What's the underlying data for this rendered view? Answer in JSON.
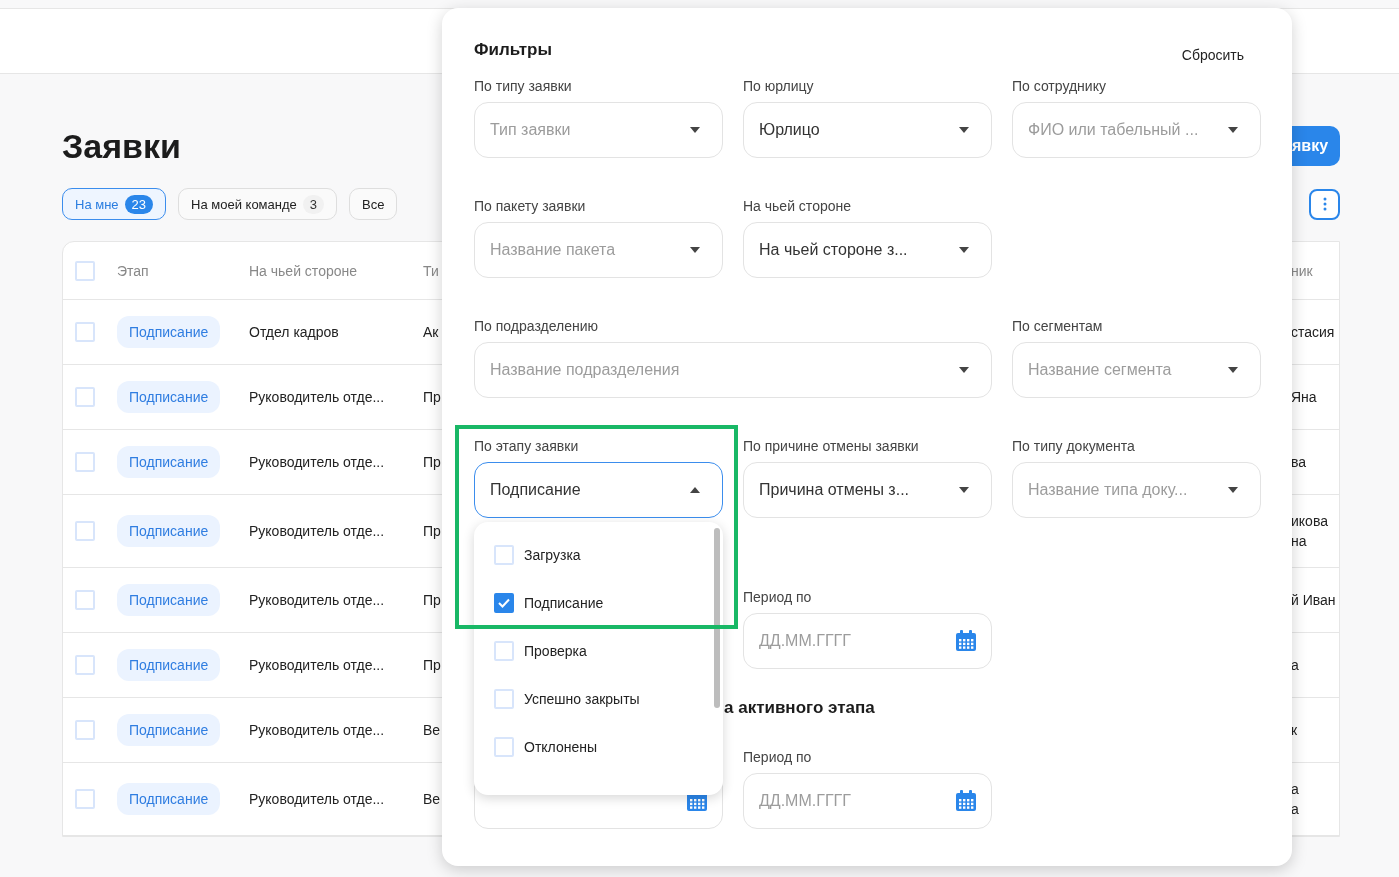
{
  "page": {
    "title": "Заявки",
    "create_button": "явку",
    "tabs": [
      {
        "label": "На мне",
        "count": "23",
        "selected": true
      },
      {
        "label": "На моей команде",
        "count": "3",
        "selected": false
      },
      {
        "label": "Все",
        "selected": false
      }
    ]
  },
  "table": {
    "all_checked": false,
    "columns": [
      "Этап",
      "На чьей стороне",
      "Ти",
      "ник"
    ],
    "rows": [
      {
        "checked": false,
        "stage": "Подписание",
        "side": "Отдел кадров",
        "column_3": "Ак",
        "column_4": [
          "стасия"
        ]
      },
      {
        "checked": false,
        "stage": "Подписание",
        "side": "Руководитель отде...",
        "column_3": "Пр",
        "column_4": [
          "Яна"
        ]
      },
      {
        "checked": false,
        "stage": "Подписание",
        "side": "Руководитель отде...",
        "column_3": "Пр",
        "column_4": [
          "ва"
        ]
      },
      {
        "checked": false,
        "stage": "Подписание",
        "side": "Руководитель отде...",
        "column_3": "Пр",
        "column_4": [
          "икова",
          "на"
        ]
      },
      {
        "checked": false,
        "stage": "Подписание",
        "side": "Руководитель отде...",
        "column_3": "Пр",
        "column_4": [
          "й Иван"
        ]
      },
      {
        "checked": false,
        "stage": "Подписание",
        "side": "Руководитель отде...",
        "column_3": "Пр",
        "column_4": [
          "а"
        ]
      },
      {
        "checked": false,
        "stage": "Подписание",
        "side": "Руководитель отде...",
        "column_3": "Ве",
        "column_4": [
          "к"
        ]
      },
      {
        "checked": false,
        "stage": "Подписание",
        "side": "Руководитель отде...",
        "column_3": "Ве",
        "column_4": [
          "а",
          "а"
        ]
      }
    ]
  },
  "filters": {
    "title": "Фильтры",
    "reset": "Сбросить",
    "fields": [
      {
        "kind": "select",
        "label": "По типу заявки",
        "placeholder": "Тип заявки"
      },
      {
        "kind": "select",
        "label": "По юрлицу",
        "value": "Юрлицо"
      },
      {
        "kind": "select",
        "label": "По сотруднику",
        "placeholder": "ФИО или табельный ..."
      },
      {
        "kind": "select",
        "label": "По пакету заявки",
        "placeholder": "Название пакета"
      },
      {
        "kind": "select",
        "label": "На чьей стороне",
        "value": "На чьей стороне з..."
      },
      {
        "kind": "empty"
      },
      {
        "kind": "wide-select",
        "label": "По подразделению",
        "placeholder": "Название подразделения"
      },
      {
        "kind": "select",
        "label": "По сегментам",
        "placeholder": "Название сегмента"
      },
      {
        "kind": "select",
        "label": "По этапу заявки",
        "value": "Подписание",
        "expanded": true,
        "options": [
          {
            "label": "Загрузка",
            "checked": false
          },
          {
            "label": "Подписание",
            "checked": true
          },
          {
            "label": "Проверка",
            "checked": false
          },
          {
            "label": "Успешно закрыты",
            "checked": false
          },
          {
            "label": "Отклонены",
            "checked": false
          }
        ]
      },
      {
        "kind": "select",
        "label": "По причине отмены заявки",
        "value": "Причина отмены з..."
      },
      {
        "kind": "select",
        "label": "По типу документа",
        "placeholder": "Название типа доку..."
      },
      {
        "kind": "empty"
      },
      {
        "kind": "date",
        "label": "Период по",
        "placeholder": "ДД.ММ.ГГГГ"
      },
      {
        "kind": "empty"
      },
      {
        "kind": "heading",
        "text": "а активного этапа"
      },
      {
        "kind": "date-bare"
      },
      {
        "kind": "date",
        "label": "Период по",
        "placeholder": "ДД.ММ.ГГГГ"
      },
      {
        "kind": "empty"
      }
    ]
  },
  "annotation": {
    "kind": "frame",
    "color": "#19b866"
  }
}
